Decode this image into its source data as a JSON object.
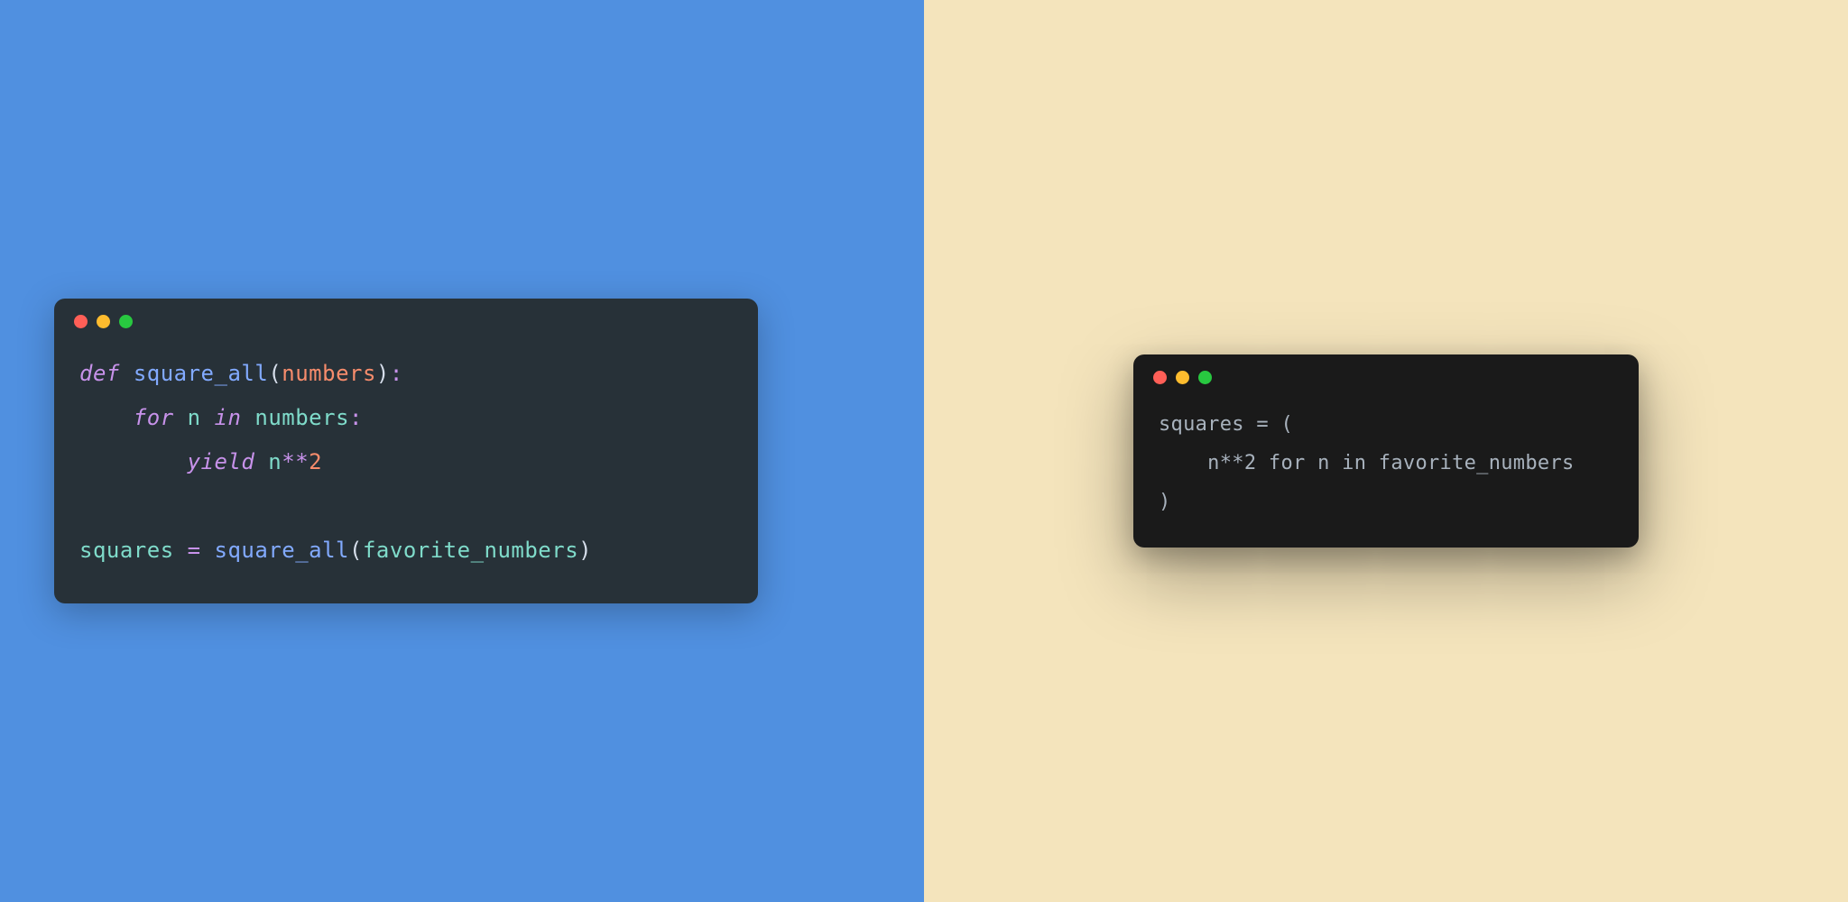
{
  "left": {
    "background": "#5090e0",
    "line1": {
      "def": "def",
      "space1": " ",
      "func": "square_all",
      "lparen": "(",
      "param": "numbers",
      "rparen": ")",
      "colon": ":"
    },
    "line2": {
      "indent": "    ",
      "for": "for",
      "space1": " ",
      "var": "n",
      "space2": " ",
      "in": "in",
      "space3": " ",
      "iter": "numbers",
      "colon": ":"
    },
    "line3": {
      "indent": "        ",
      "yield": "yield",
      "space1": " ",
      "var": "n",
      "op": "**",
      "num": "2"
    },
    "line4": {
      "lhs": "squares",
      "space1": " ",
      "eq": "=",
      "space2": " ",
      "func": "square_all",
      "lparen": "(",
      "arg": "favorite_numbers",
      "rparen": ")"
    }
  },
  "right": {
    "background": "#f4e4bc",
    "line1": "squares = (",
    "line2": "    n**2 for n in favorite_numbers",
    "line3": ")"
  }
}
